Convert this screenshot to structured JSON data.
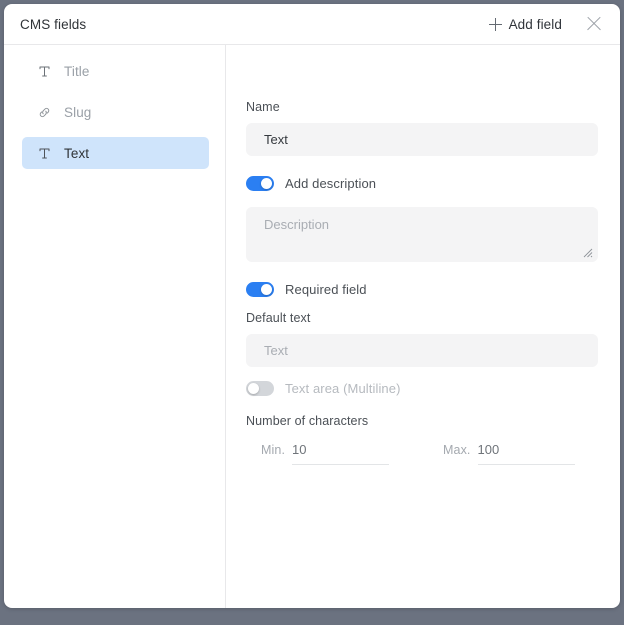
{
  "header": {
    "title": "CMS fields",
    "add_field_label": "Add field",
    "plus_icon": "plus-icon",
    "close_icon": "close-icon"
  },
  "sidebar": {
    "items": [
      {
        "label": "Title",
        "icon": "text-field-icon",
        "selected": false
      },
      {
        "label": "Slug",
        "icon": "link-icon",
        "selected": false
      },
      {
        "label": "Text",
        "icon": "text-field-icon",
        "selected": true
      }
    ]
  },
  "form": {
    "name": {
      "label": "Name",
      "value": "Text"
    },
    "add_description": {
      "label": "Add description",
      "enabled": true,
      "placeholder": "Description"
    },
    "required_field": {
      "label": "Required field",
      "enabled": true
    },
    "default_text": {
      "label": "Default text",
      "placeholder": "Text"
    },
    "text_area_multiline": {
      "label": "Text area (Multiline)",
      "enabled": false
    },
    "number_of_characters": {
      "label": "Number of characters",
      "min_caption": "Min.",
      "min_value": "10",
      "max_caption": "Max.",
      "max_value": "100"
    }
  },
  "colors": {
    "accent": "#2b7ff2",
    "selected_item_bg": "#cfe4fb",
    "input_bg": "#f4f4f5",
    "toggle_off": "#d3d6da",
    "page_bg": "#6b7280"
  }
}
